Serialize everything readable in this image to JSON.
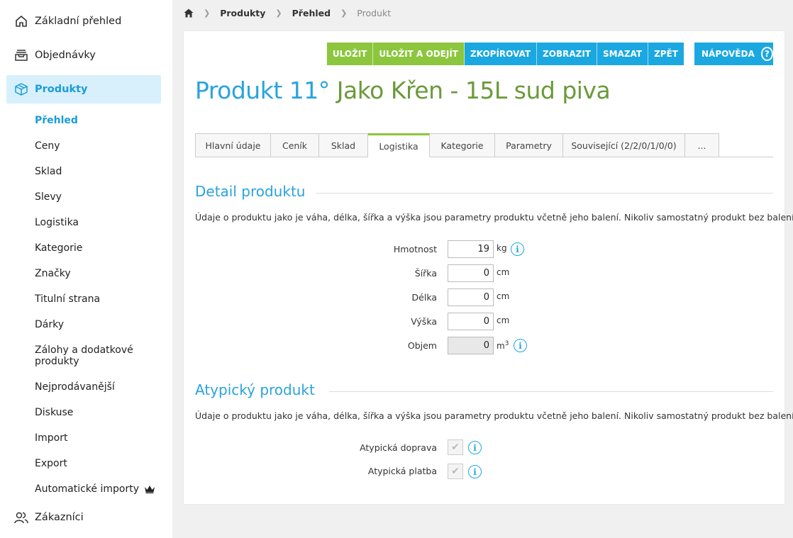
{
  "sidebar": {
    "top_items": [
      {
        "label": "Základní přehled",
        "icon": "home-icon"
      },
      {
        "label": "Objednávky",
        "icon": "inbox-icon"
      }
    ],
    "active_item": {
      "label": "Produkty",
      "icon": "box-icon"
    },
    "sub_items": [
      {
        "label": "Přehled",
        "active": true
      },
      {
        "label": "Ceny"
      },
      {
        "label": "Sklad"
      },
      {
        "label": "Slevy"
      },
      {
        "label": "Logistika"
      },
      {
        "label": "Kategorie"
      },
      {
        "label": "Značky"
      },
      {
        "label": "Titulní strana"
      },
      {
        "label": "Dárky"
      },
      {
        "label": "Zálohy a dodatkové produkty"
      },
      {
        "label": "Nejprodávanější"
      },
      {
        "label": "Diskuse"
      },
      {
        "label": "Import"
      },
      {
        "label": "Export"
      },
      {
        "label": "Automatické importy",
        "icon": "crown-icon"
      }
    ],
    "bottom_item": {
      "label": "Zákazníci",
      "icon": "users-icon"
    }
  },
  "breadcrumb": [
    "Produkty",
    "Přehled",
    "Produkt"
  ],
  "toolbar": {
    "buttons": [
      {
        "label": "ULOŽIT",
        "color": "#8cc63e"
      },
      {
        "label": "ULOŽIT A ODEJÍT",
        "color": "#8cc63e"
      },
      {
        "label": "ZKOPÍROVAT",
        "color": "#1ba8e0"
      },
      {
        "label": "ZOBRAZIT",
        "color": "#1ba8e0"
      },
      {
        "label": "SMAZAT",
        "color": "#1ba8e0"
      },
      {
        "label": "ZPĚT",
        "color": "#1ba8e0"
      }
    ],
    "help_label": "NÁPOVĚDA"
  },
  "title": {
    "part1": "Produkt 11°",
    "part2": "Jako Křen - 15L sud piva"
  },
  "tabs": [
    "Hlavní údaje",
    "Ceník",
    "Sklad",
    "Logistika",
    "Kategorie",
    "Parametry",
    "Související (2/2/0/1/0/0)",
    "..."
  ],
  "active_tab": "Logistika",
  "detail": {
    "title": "Detail produktu",
    "description": "Údaje o produktu jako je váha, délka, šířka a výška jsou parametry produktu včetně jeho balení. Nikoliv samostatný produkt bez balení.",
    "fields": [
      {
        "label": "Hmotnost",
        "value": "19",
        "unit": "kg",
        "info": true
      },
      {
        "label": "Šířka",
        "value": "0",
        "unit": "cm"
      },
      {
        "label": "Délka",
        "value": "0",
        "unit": "cm"
      },
      {
        "label": "Výška",
        "value": "0",
        "unit": "cm"
      },
      {
        "label": "Objem",
        "value": "0",
        "unit": "m",
        "unit_sup": "3",
        "info": true,
        "disabled": true
      }
    ]
  },
  "atypical": {
    "title": "Atypický produkt",
    "description": "Údaje o produktu jako je váha, délka, šířka a výška jsou parametry produktu včetně jeho balení. Nikoliv samostatný produkt bez balení.",
    "fields": [
      {
        "label": "Atypická doprava",
        "checked": true
      },
      {
        "label": "Atypická platba",
        "checked": true
      }
    ]
  },
  "colors": {
    "accent_blue": "#1ba8e0",
    "accent_green": "#8cc63e",
    "title_green": "#6a9a3a"
  }
}
